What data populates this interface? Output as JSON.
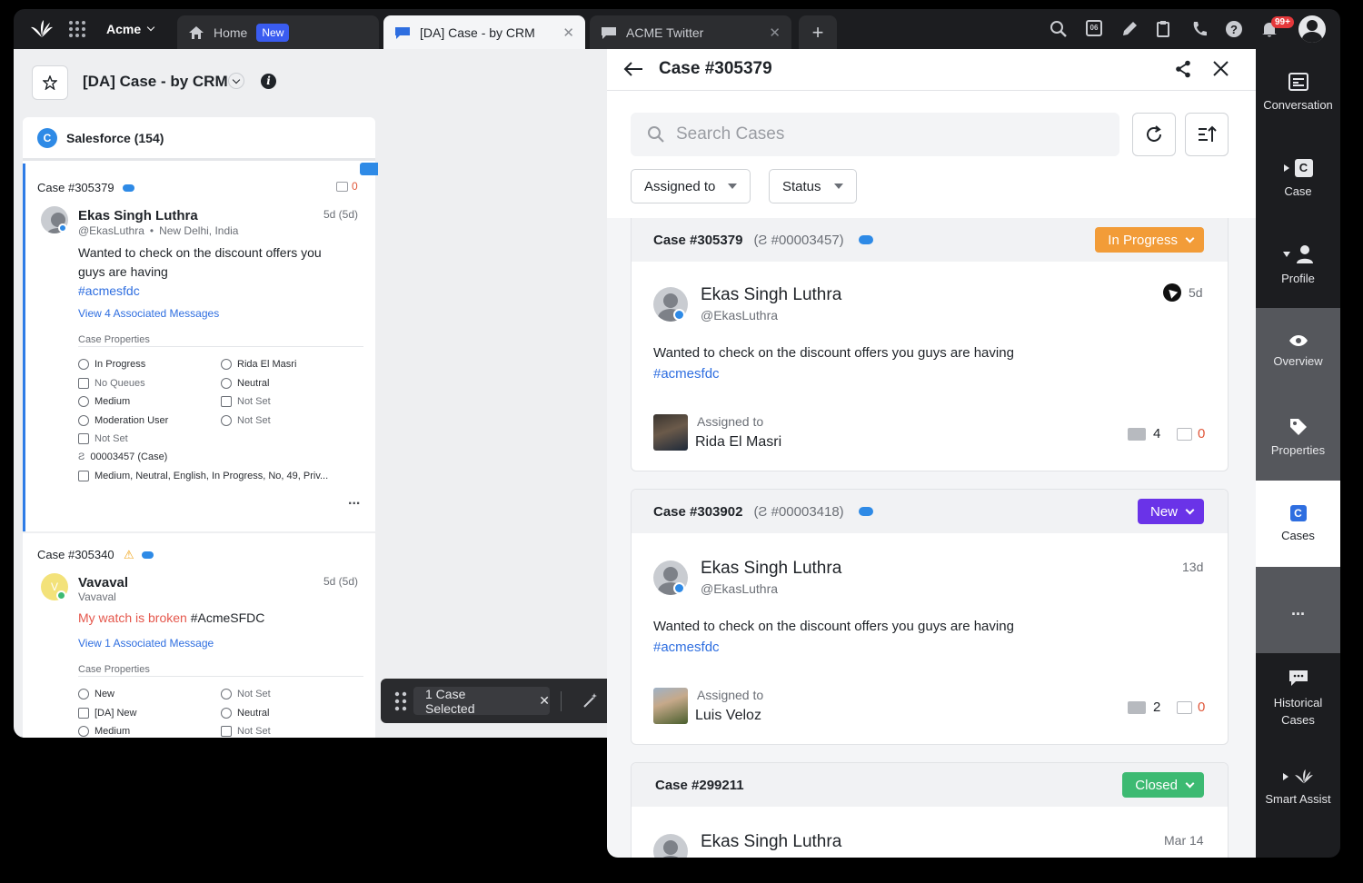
{
  "topbar": {
    "org": "Acme",
    "tabs": [
      {
        "label": "Home",
        "badge": "New"
      },
      {
        "label": "[DA] Case - by CRM"
      },
      {
        "label": "ACME Twitter"
      }
    ],
    "calendar_num": "06",
    "notification_count": "99+"
  },
  "left": {
    "view_title": "[DA] Case - by CRM",
    "source": "Salesforce (154)",
    "cases": [
      {
        "case_id": "Case #305379",
        "unread": "0",
        "name": "Ekas Singh Luthra",
        "age": "5d (5d)",
        "handle": "@EkasLuthra",
        "location": "New Delhi, India",
        "message_line1": "Wanted to check on the discount offers you",
        "message_line2": "guys are having",
        "hashtag": "#acmesfdc",
        "view_messages": "View 4 Associated Messages",
        "props_title": "Case Properties",
        "props_left": [
          "In Progress",
          "No Queues",
          "Medium",
          "Moderation User",
          "Not Set",
          "00003457 (Case)",
          "Medium, Neutral, English, In Progress, No, 49, Priv..."
        ],
        "props_right": [
          "Rida El Masri",
          "Neutral",
          "Not Set",
          "Not Set"
        ],
        "more": "..."
      },
      {
        "case_id": "Case #305340",
        "name": "Vavaval",
        "age": "5d (5d)",
        "handle": "Vavaval",
        "message_red": "My watch is broken",
        "message_rest": " #AcmeSFDC",
        "view_messages": "View 1 Associated Message",
        "props_title": "Case Properties",
        "props_left": [
          "New",
          "[DA] New",
          "Medium"
        ],
        "props_right": [
          "Not Set",
          "Neutral",
          "Not Set"
        ]
      }
    ],
    "bulk": {
      "label": "1 Case Selected"
    }
  },
  "right": {
    "title": "Case #305379",
    "search_placeholder": "Search Cases",
    "filters": [
      "Assigned to",
      "Status"
    ],
    "cards": [
      {
        "case_id": "Case #305379",
        "crm_id": "(Ƨ #00003457)",
        "status": "In Progress",
        "status_color": "#f29c38",
        "name": "Ekas Singh Luthra",
        "handle": "@EkasLuthra",
        "age": "5d",
        "message": "Wanted to check on the discount offers you guys are having",
        "hashtag": "#acmesfdc",
        "assigned_label": "Assigned to",
        "assignee": "Rida El Masri",
        "messages_count": "4",
        "unread_count": "0"
      },
      {
        "case_id": "Case #303902",
        "crm_id": "(Ƨ #00003418)",
        "status": "New",
        "status_color": "#6a33e8",
        "name": "Ekas Singh Luthra",
        "handle": "@EkasLuthra",
        "age": "13d",
        "message": "Wanted to check on the discount offers you guys are having",
        "hashtag": "#acmesfdc",
        "assigned_label": "Assigned to",
        "assignee": "Luis Veloz",
        "messages_count": "2",
        "unread_count": "0"
      },
      {
        "case_id": "Case #299211",
        "status": "Closed",
        "status_color": "#3dba72",
        "name": "Ekas Singh Luthra",
        "age": "Mar 14"
      }
    ]
  },
  "rail": {
    "items": [
      "Conversation",
      "Case",
      "Profile",
      "Overview",
      "Properties",
      "Cases",
      "...",
      "Historical Cases",
      "Smart Assist"
    ]
  }
}
